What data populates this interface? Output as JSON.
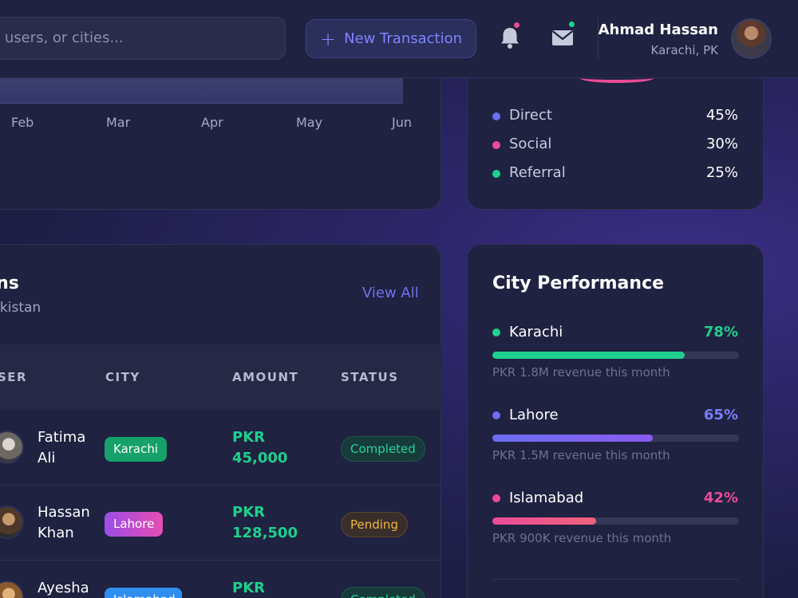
{
  "header": {
    "search_placeholder": "s, users, or cities...",
    "new_transaction_label": "New Transaction",
    "user_name": "Ahmad Hassan",
    "user_location": "Karachi, PK"
  },
  "revenue_chart": {
    "months": [
      "Feb",
      "Mar",
      "Apr",
      "May",
      "Jun"
    ]
  },
  "traffic_sources": {
    "items": [
      {
        "label": "Direct",
        "value": "45%",
        "color": "#6c6ff0"
      },
      {
        "label": "Social",
        "value": "30%",
        "color": "#ec4b9a"
      },
      {
        "label": "Referral",
        "value": "25%",
        "color": "#1fcf8d"
      }
    ]
  },
  "transactions": {
    "title": "ons",
    "subtitle": "Pakistan",
    "view_all": "View All",
    "columns": [
      "SER",
      "CITY",
      "AMOUNT",
      "STATUS"
    ],
    "rows": [
      {
        "name_first": "Fatima",
        "name_last": "Ali",
        "city": "Karachi",
        "city_color": "#16a06a",
        "amount_currency": "PKR",
        "amount_value": "45,000",
        "status": "Completed"
      },
      {
        "name_first": "Hassan",
        "name_last": "Khan",
        "city": "Lahore",
        "city_color": "#b34de6",
        "amount_currency": "PKR",
        "amount_value": "128,500",
        "status": "Pending"
      },
      {
        "name_first": "Ayesha",
        "name_last": "",
        "city": "Islamabad",
        "city_color": "#2f8ef0",
        "amount_currency": "PKR",
        "amount_value": "",
        "status": "Completed"
      }
    ]
  },
  "city_performance": {
    "title": "City Performance",
    "cities": [
      {
        "name": "Karachi",
        "percent": "78%",
        "fill": 0.78,
        "revenue_note": "PKR 1.8M revenue this month",
        "color": "#1fcf8d"
      },
      {
        "name": "Lahore",
        "percent": "65%",
        "fill": 0.65,
        "revenue_note": "PKR 1.5M revenue this month",
        "color": "#6c6ff0"
      },
      {
        "name": "Islamabad",
        "percent": "42%",
        "fill": 0.42,
        "revenue_note": "PKR 900K revenue this month",
        "color": "#ec4b9a"
      }
    ]
  }
}
